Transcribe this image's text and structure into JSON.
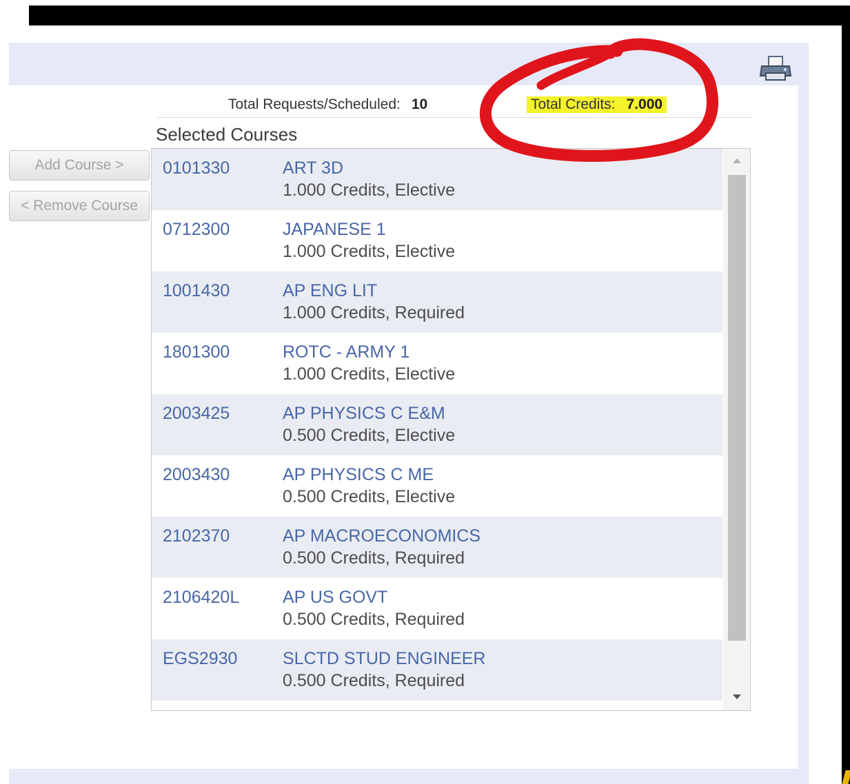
{
  "summary": {
    "requests_label": "Total Requests/Scheduled:",
    "requests_value": "10",
    "credits_label": "Total Credits:",
    "credits_value": "7.000"
  },
  "section_title": "Selected Courses",
  "buttons": {
    "add": "Add Course >",
    "remove": "< Remove Course"
  },
  "courses": [
    {
      "code": "0101330",
      "name": "ART 3D",
      "detail": "1.000 Credits,  Elective"
    },
    {
      "code": "0712300",
      "name": "JAPANESE 1",
      "detail": "1.000 Credits,  Elective"
    },
    {
      "code": "1001430",
      "name": "AP ENG LIT",
      "detail": "1.000 Credits,  Required"
    },
    {
      "code": "1801300",
      "name": "ROTC - ARMY 1",
      "detail": "1.000 Credits,  Elective"
    },
    {
      "code": "2003425",
      "name": "AP PHYSICS C E&M",
      "detail": "0.500 Credits,  Elective"
    },
    {
      "code": "2003430",
      "name": "AP PHYSICS C ME",
      "detail": "0.500 Credits,  Elective"
    },
    {
      "code": "2102370",
      "name": "AP MACROECONOMICS",
      "detail": "0.500 Credits,  Required"
    },
    {
      "code": "2106420L",
      "name": "AP US GOVT",
      "detail": "0.500 Credits,  Required"
    },
    {
      "code": "EGS2930",
      "name": "SLCTD STUD ENGINEER",
      "detail": "0.500 Credits,  Required"
    }
  ],
  "icons": {
    "print": "printer-icon"
  },
  "colors": {
    "link_blue": "#4867a8",
    "header_bg": "#e6e9f7",
    "highlight": "#f4f22a",
    "annotation_red": "#e0141b"
  }
}
